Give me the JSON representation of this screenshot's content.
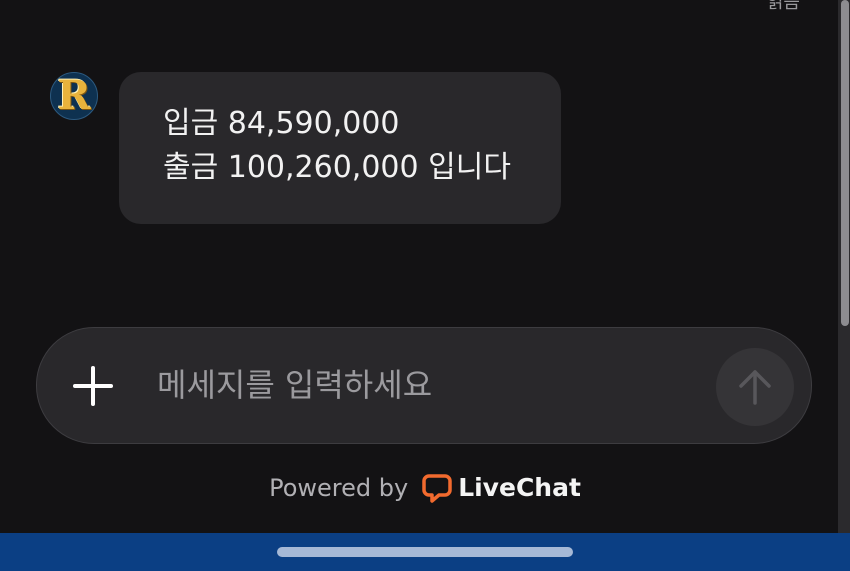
{
  "header": {
    "read_status": "읽음"
  },
  "message": {
    "avatar_letter": "R",
    "lines": [
      "입금 84,590,000",
      "출금 100,260,000 입니다"
    ]
  },
  "composer": {
    "placeholder": "메세지를 입력하세요",
    "value": ""
  },
  "footer": {
    "powered_by": "Powered by",
    "brand": "LiveChat",
    "brand_color": "#f26a2e"
  },
  "icons": {
    "add": "plus-icon",
    "send": "arrow-up-icon",
    "brand": "livechat-logo-icon"
  }
}
